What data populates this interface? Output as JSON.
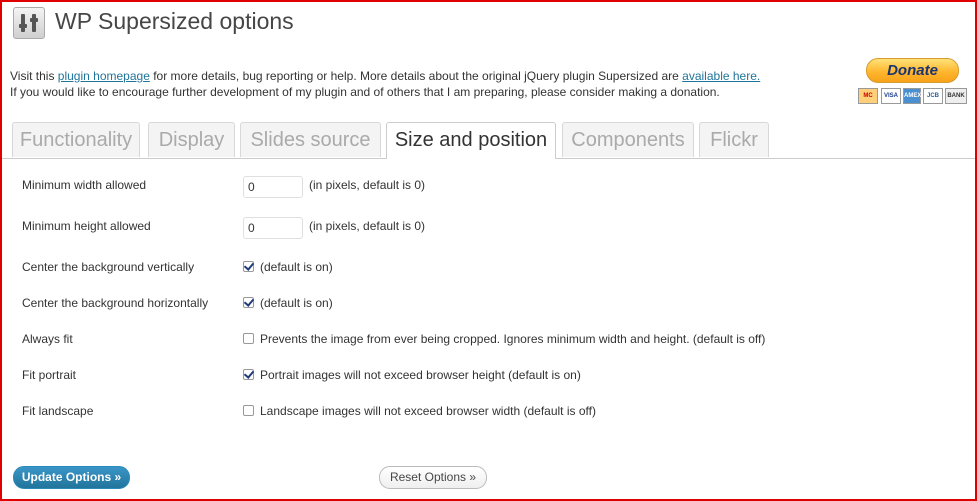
{
  "header": {
    "title": "WP Supersized options"
  },
  "intro": {
    "line1_before": "Visit this ",
    "line1_link1": "plugin homepage",
    "line1_middle": " for more details, bug reporting or help. More details about the original jQuery plugin Supersized are ",
    "line1_link2": "available here.",
    "line2": "If you would like to encourage further development of my plugin and of others that I am preparing, please consider making a donation."
  },
  "donate": {
    "label": "Donate",
    "cards": [
      "MC",
      "VISA",
      "AMEX",
      "JCB",
      "",
      "BANK"
    ]
  },
  "tabs": [
    {
      "label": "Functionality",
      "active": false
    },
    {
      "label": "Display",
      "active": false
    },
    {
      "label": "Slides source",
      "active": false
    },
    {
      "label": "Size and position",
      "active": true
    },
    {
      "label": "Components",
      "active": false
    },
    {
      "label": "Flickr",
      "active": false
    }
  ],
  "settings": {
    "min_width": {
      "label": "Minimum width allowed",
      "value": "0",
      "hint": "(in pixels, default is 0)"
    },
    "min_height": {
      "label": "Minimum height allowed",
      "value": "0",
      "hint": "(in pixels, default is 0)"
    },
    "center_vertical": {
      "label": "Center the background vertically",
      "checked": true,
      "hint": "(default is on)"
    },
    "center_horizontal": {
      "label": "Center the background horizontally",
      "checked": true,
      "hint": "(default is on)"
    },
    "always_fit": {
      "label": "Always fit",
      "checked": false,
      "hint": "Prevents the image from ever being cropped. Ignores minimum width and height. (default is off)"
    },
    "fit_portrait": {
      "label": "Fit portrait",
      "checked": true,
      "hint": "Portrait images will not exceed browser height (default is on)"
    },
    "fit_landscape": {
      "label": "Fit landscape",
      "checked": false,
      "hint": "Landscape images will not exceed browser width (default is off)"
    }
  },
  "buttons": {
    "update": "Update Options »",
    "reset": "Reset Options »"
  }
}
